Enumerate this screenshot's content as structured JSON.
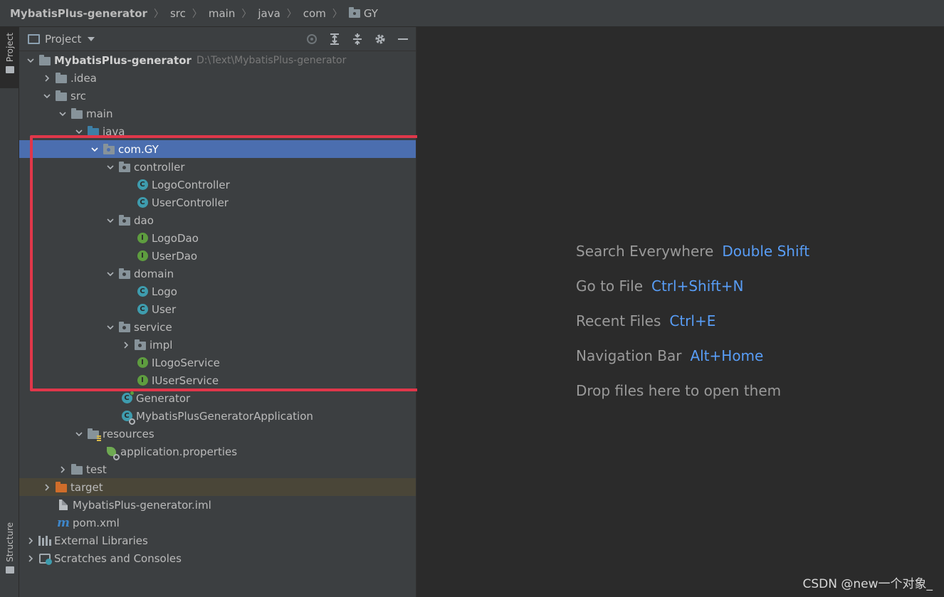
{
  "breadcrumb": [
    "MybatisPlus-generator",
    "src",
    "main",
    "java",
    "com",
    "GY"
  ],
  "toolwindow": {
    "project_tab": "Project",
    "structure_tab": "Structure"
  },
  "panel": {
    "title": "Project"
  },
  "tree": {
    "root_label": "MybatisPlus-generator",
    "root_path": "D:\\Text\\MybatisPlus-generator",
    "idea": ".idea",
    "src": "src",
    "main": "main",
    "java": "java",
    "com_gy": "com.GY",
    "controller": "controller",
    "logo_controller": "LogoController",
    "user_controller": "UserController",
    "dao": "dao",
    "logo_dao": "LogoDao",
    "user_dao": "UserDao",
    "domain": "domain",
    "logo": "Logo",
    "user": "User",
    "service": "service",
    "impl": "impl",
    "ilogo_service": "ILogoService",
    "iuser_service": "IUserService",
    "generator": "Generator",
    "app": "MybatisPlusGeneratorApplication",
    "resources": "resources",
    "app_props": "application.properties",
    "test": "test",
    "target": "target",
    "iml": "MybatisPlus-generator.iml",
    "pom": "pom.xml",
    "ext_libs": "External Libraries",
    "scratches": "Scratches and Consoles"
  },
  "editor": {
    "hints": [
      {
        "text": "Search Everywhere",
        "key": "Double Shift"
      },
      {
        "text": "Go to File",
        "key": "Ctrl+Shift+N"
      },
      {
        "text": "Recent Files",
        "key": "Ctrl+E"
      },
      {
        "text": "Navigation Bar",
        "key": "Alt+Home"
      },
      {
        "text": "Drop files here to open them",
        "key": ""
      }
    ]
  },
  "watermark": "CSDN @new一个对象_",
  "colors": {
    "highlight": "#e0374a",
    "selection": "#4b6eaf",
    "link": "#589df6"
  }
}
